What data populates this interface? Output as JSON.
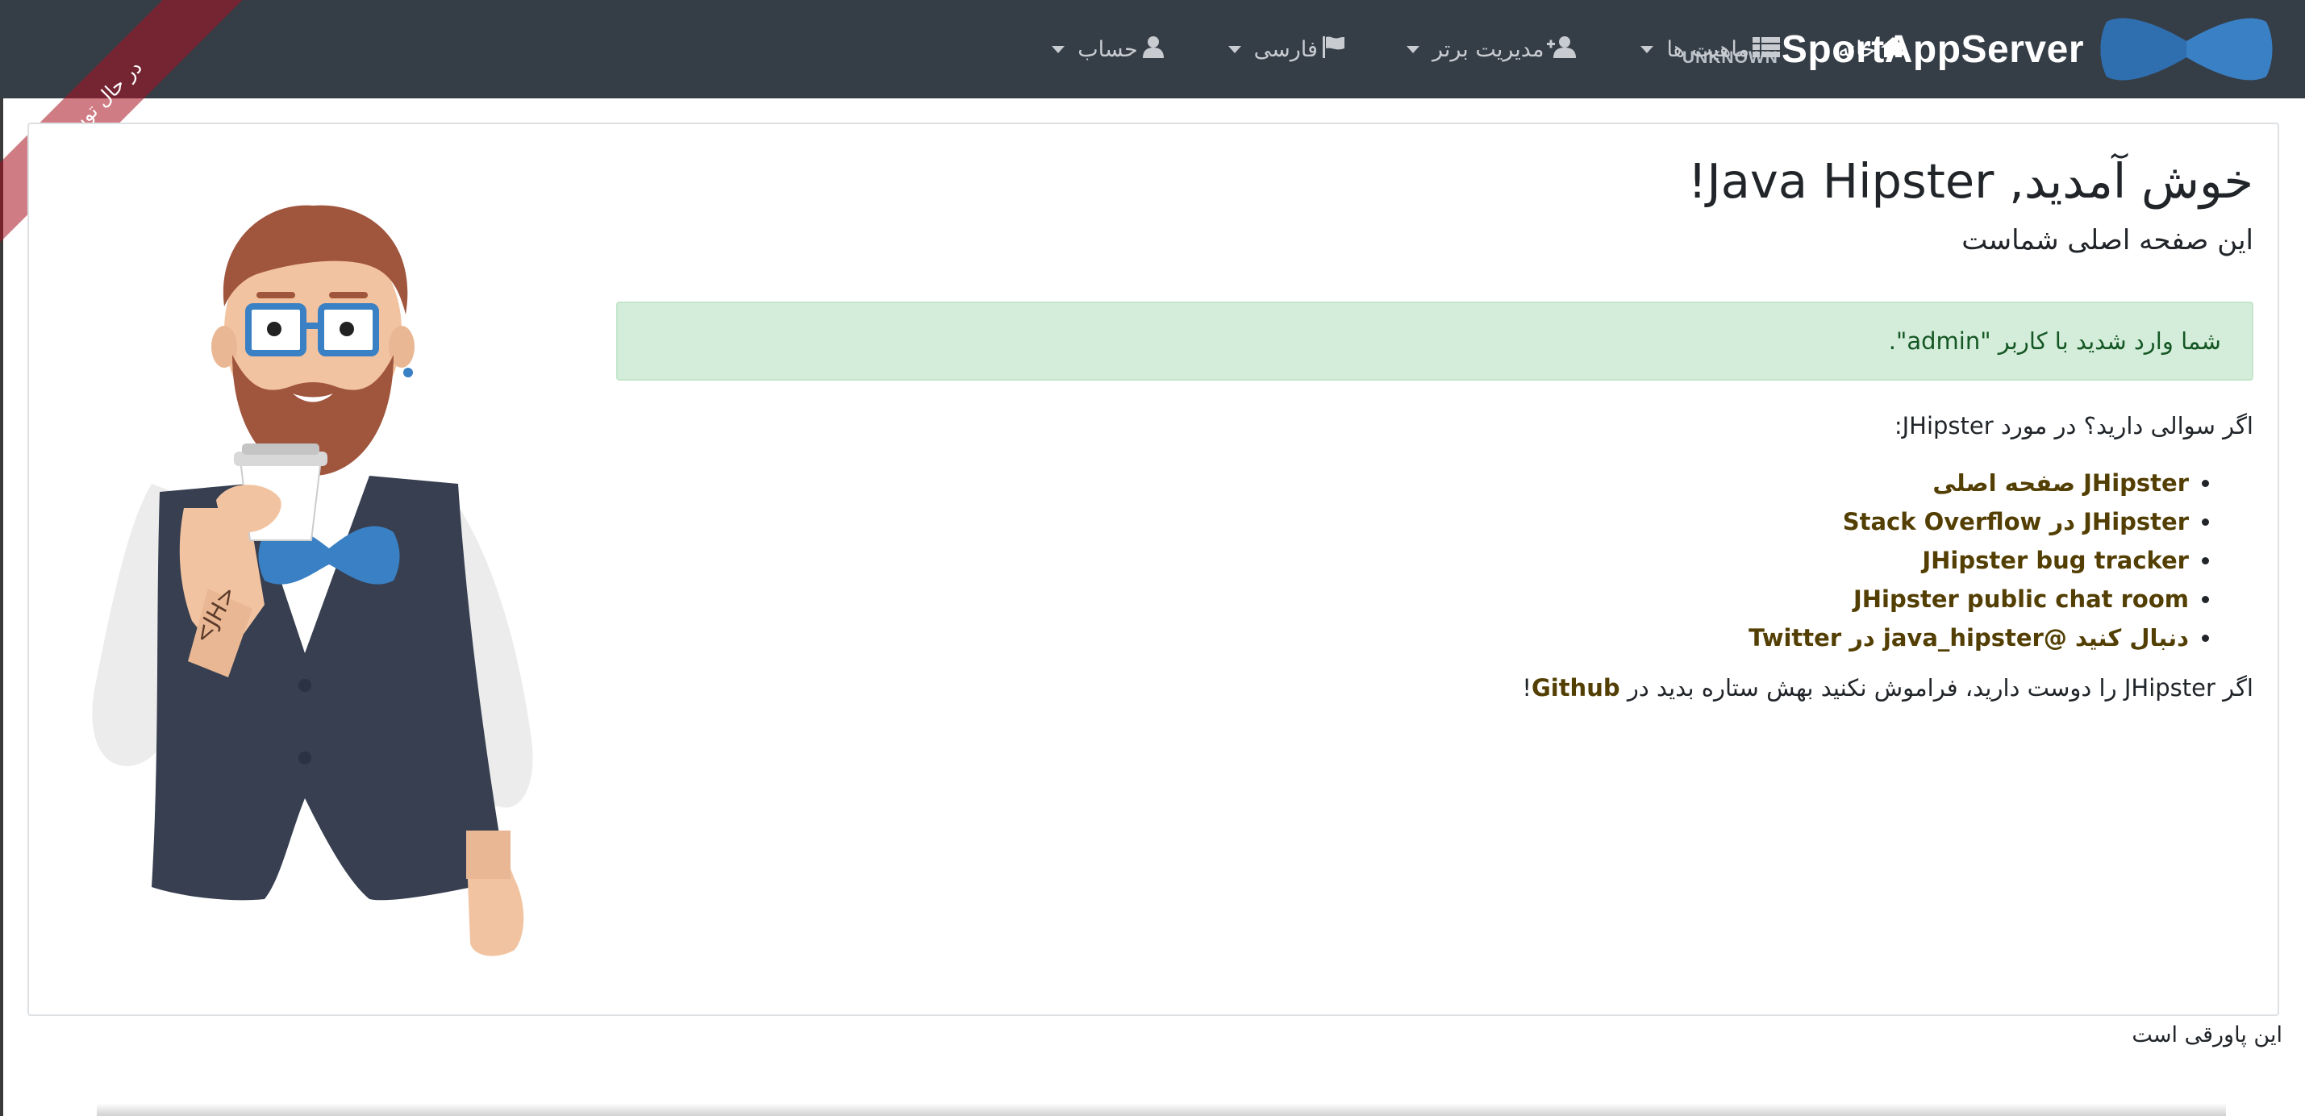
{
  "navbar": {
    "brand_title": "SportAppServer",
    "brand_version": "UNKNOWN",
    "items": {
      "home": "خانه",
      "entities": "ماهیت ها",
      "admin": "مدیریت برتر",
      "language": "فارسی",
      "account": "حساب"
    },
    "icons": {
      "home": "home-icon",
      "entities": "th-list-icon",
      "admin": "user-plus-icon",
      "language": "flag-icon",
      "account": "user-icon"
    },
    "background": "#353d47"
  },
  "ribbon": {
    "label": "در حال توسعه"
  },
  "main": {
    "welcome": "خوش آمدید, Java Hipster!",
    "subtitle": "این صفحه اصلی شماست",
    "alert_text": "شما وارد شدید با کاربر \"admin\".",
    "question": "اگر سوالی دارید؟ در مورد JHipster:",
    "links": [
      "JHipster صفحه اصلی",
      "JHipster در Stack Overflow",
      "JHipster bug tracker",
      "JHipster public chat room",
      "دنبال کنید @java_hipster در Twitter"
    ],
    "github_text": "اگر JHipster را دوست دارید، فراموش نکنید بهش ستاره بدید در ",
    "github_link": "Github",
    "github_suffix": "!"
  },
  "footer": {
    "text": "این پاورقی است"
  },
  "colors": {
    "link": "#533f03",
    "alert_bg": "#d4edda",
    "alert_text": "#155724",
    "ribbon": "#aa1020"
  }
}
